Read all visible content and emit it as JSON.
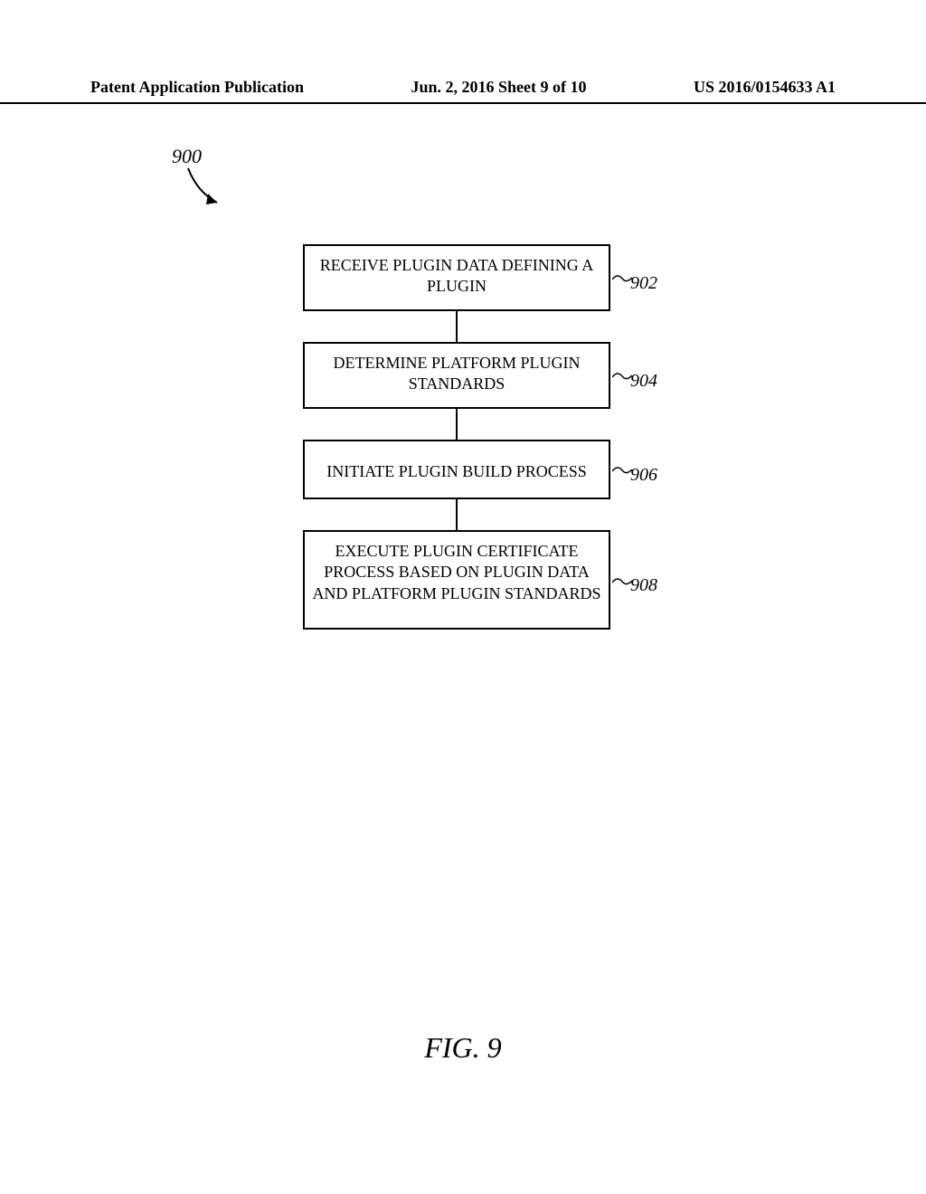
{
  "header": {
    "left": "Patent Application Publication",
    "center": "Jun. 2, 2016  Sheet 9 of 10",
    "right": "US 2016/0154633 A1"
  },
  "diagram": {
    "ref": "900",
    "boxes": [
      {
        "text": "RECEIVE PLUGIN DATA DEFINING A PLUGIN",
        "label": "902"
      },
      {
        "text": "DETERMINE PLATFORM PLUGIN STANDARDS",
        "label": "904"
      },
      {
        "text": "INITIATE PLUGIN BUILD PROCESS",
        "label": "906"
      },
      {
        "text": "EXECUTE PLUGIN CERTIFICATE PROCESS BASED ON PLUGIN DATA AND PLATFORM PLUGIN STANDARDS",
        "label": "908"
      }
    ]
  },
  "figure_caption": "FIG. 9"
}
